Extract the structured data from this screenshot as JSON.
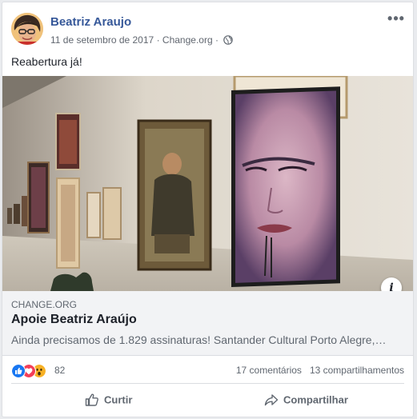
{
  "post": {
    "author": "Beatriz Araujo",
    "date": "11 de setembro de 2017",
    "source": "Change.org",
    "separator": "·",
    "text": "Reabertura já!",
    "more_icon": "more-options-icon",
    "privacy_icon": "globe-icon"
  },
  "link": {
    "domain": "CHANGE.ORG",
    "title": "Apoie Beatriz Araújo",
    "description": "Ainda precisamos de 1.829 assinaturas! Santander Cultural Porto Alegre,…",
    "info_icon": "info-icon",
    "info_glyph": "i"
  },
  "reactions": {
    "types": [
      "like",
      "love",
      "wow"
    ],
    "count": "82",
    "comments": "17 comentários",
    "shares": "13 compartilhamentos"
  },
  "actions": {
    "like": "Curtir",
    "share": "Compartilhar"
  },
  "colors": {
    "link_blue": "#365899",
    "like_blue": "#1877f2",
    "love_red": "#f33e58",
    "wow_yellow": "#f7b125"
  }
}
